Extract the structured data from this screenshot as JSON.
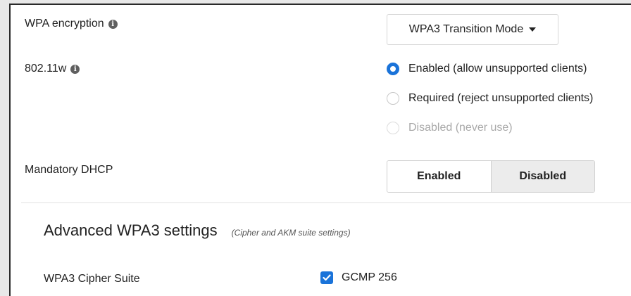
{
  "wpa_encryption": {
    "label": "WPA encryption",
    "value": "WPA3 Transition Mode"
  },
  "dot11w": {
    "label": "802.11w",
    "options": [
      {
        "label": "Enabled (allow unsupported clients)",
        "checked": true,
        "disabled": false
      },
      {
        "label": "Required (reject unsupported clients)",
        "checked": false,
        "disabled": false
      },
      {
        "label": "Disabled (never use)",
        "checked": false,
        "disabled": true
      }
    ]
  },
  "mandatory_dhcp": {
    "label": "Mandatory DHCP",
    "options": [
      "Enabled",
      "Disabled"
    ],
    "selected": "Disabled"
  },
  "advanced": {
    "title": "Advanced WPA3 settings",
    "note": "(Cipher and AKM suite settings)"
  },
  "cipher_suite": {
    "label": "WPA3 Cipher Suite",
    "option": "GCMP 256",
    "checked": true
  },
  "colors": {
    "accent": "#1a73d9",
    "selected_toggle_bg": "#ececec"
  },
  "icons": {
    "info": "info-icon",
    "caret": "caret-down-icon",
    "check": "check-icon"
  }
}
